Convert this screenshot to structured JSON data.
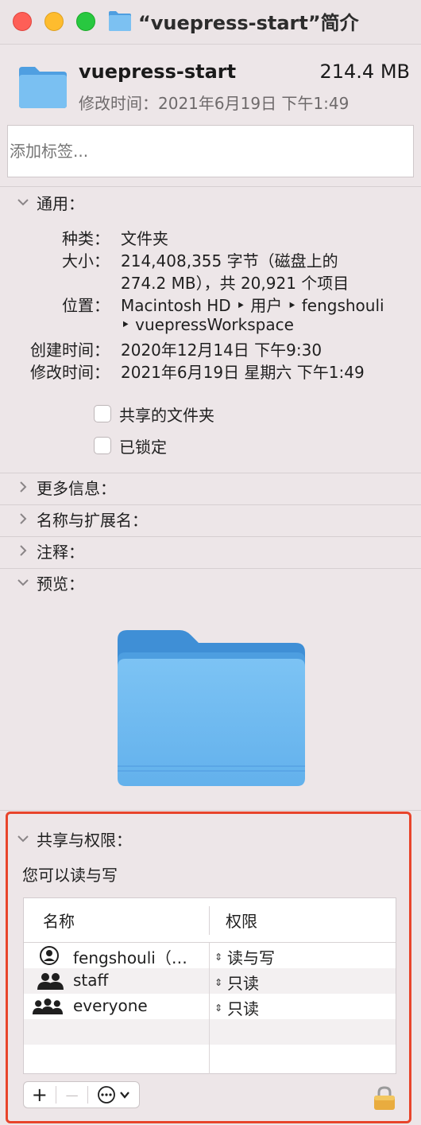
{
  "window": {
    "title": "“vuepress-start”简介"
  },
  "header": {
    "name": "vuepress-start",
    "size": "214.4 MB",
    "modified_label": "修改时间：",
    "modified_value": "2021年6月19日 下午1:49"
  },
  "tags": {
    "placeholder": "添加标签..."
  },
  "general": {
    "title": "通用：",
    "kind_label": "种类：",
    "kind_value": "文件夹",
    "size_label": "大小：",
    "size_value_line1": "214,408,355 字节（磁盘上的",
    "size_value_line2": "274.2 MB），共 20,921 个项目",
    "where_label": "位置：",
    "where_line1": "Macintosh HD ‣ 用户 ‣ fengshouli",
    "where_line2": "‣ vuepressWorkspace",
    "created_label": "创建时间：",
    "created_value": "2020年12月14日 下午9:30",
    "modified_label": "修改时间：",
    "modified_value": "2021年6月19日 星期六 下午1:49",
    "shared_folder_label": "共享的文件夹",
    "locked_label": "已锁定"
  },
  "sections": {
    "more_info": "更多信息：",
    "name_extension": "名称与扩展名：",
    "comments": "注释：",
    "preview": "预览："
  },
  "sharing": {
    "title": "共享与权限：",
    "description": "您可以读与写",
    "col_name": "名称",
    "col_privilege": "权限",
    "rows": [
      {
        "name": "fengshouli（…",
        "privilege": "读与写",
        "icon": "user-icon"
      },
      {
        "name": "staff",
        "privilege": "只读",
        "icon": "group-icon"
      },
      {
        "name": "everyone",
        "privilege": "只读",
        "icon": "everyone-icon"
      }
    ],
    "add_symbol": "+",
    "remove_symbol": "—"
  },
  "colors": {
    "folder_blue": "#6fb8ef",
    "highlight_red": "#e8442b",
    "background": "#ede6e8"
  }
}
